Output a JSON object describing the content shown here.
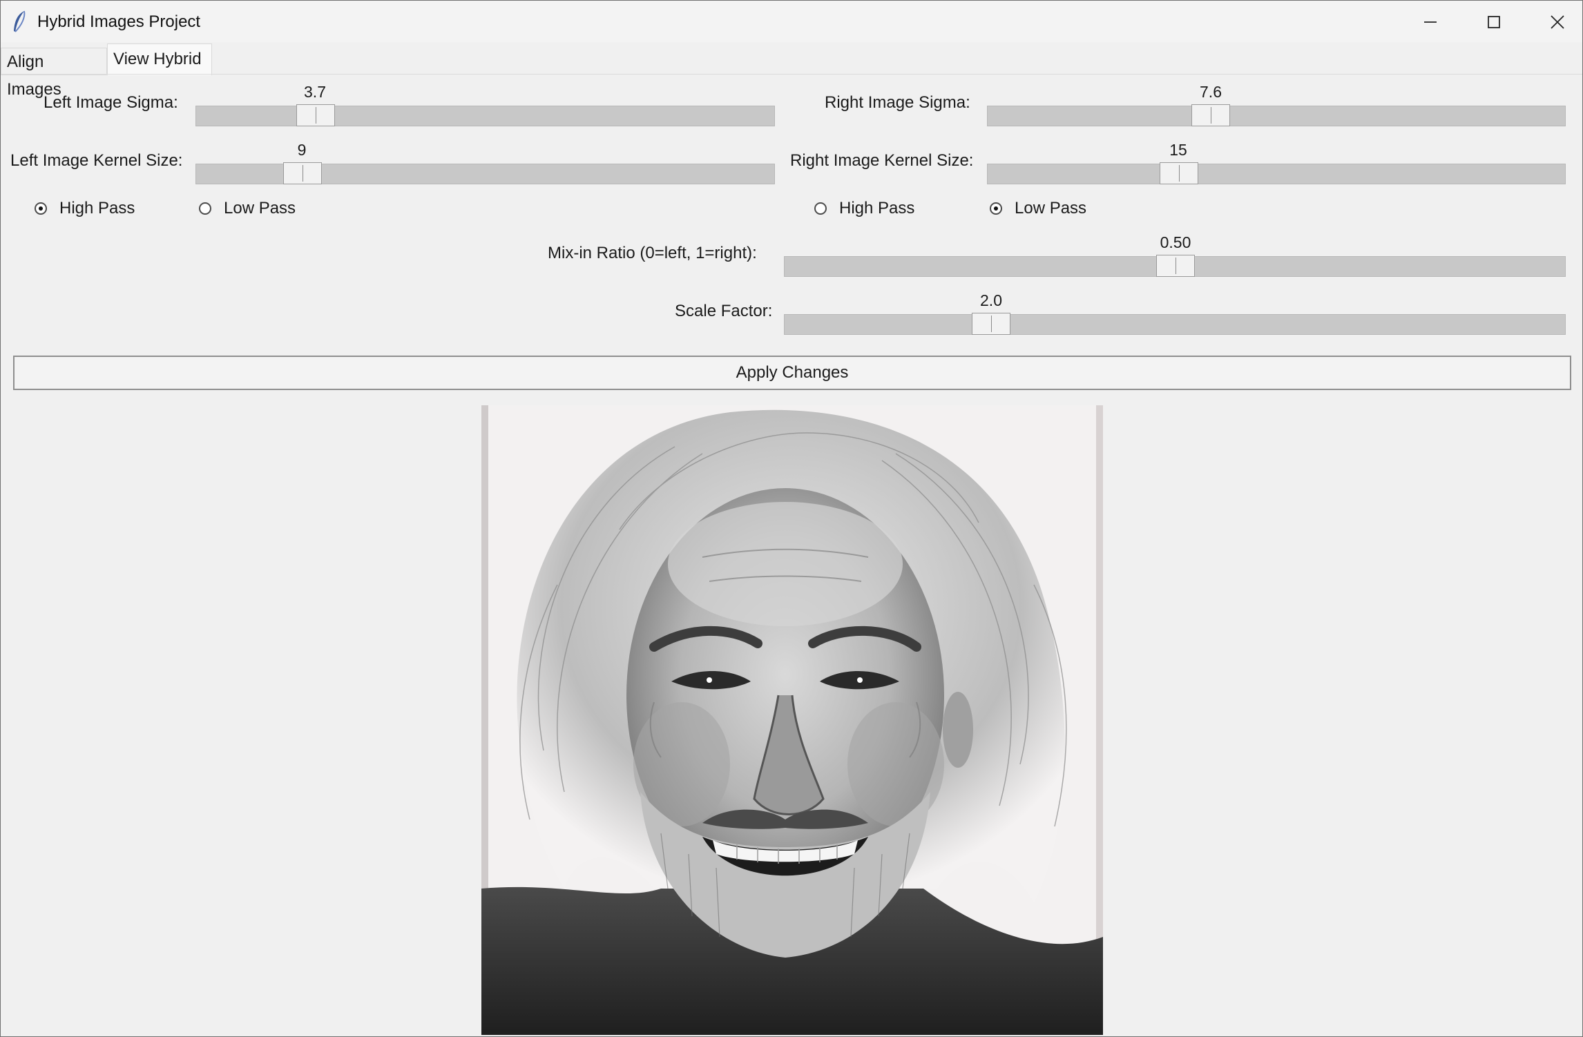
{
  "window": {
    "title": "Hybrid Images Project",
    "app_icon": "feather-icon",
    "controls": [
      "minimize-icon",
      "maximize-icon",
      "close-icon"
    ]
  },
  "tabs": [
    {
      "label": "Align Images",
      "selected": false
    },
    {
      "label": "View Hybrid",
      "selected": true
    }
  ],
  "left": {
    "sigma_label": "Left Image Sigma:",
    "sigma_value": "3.7",
    "kernel_label": "Left Image Kernel Size:",
    "kernel_value": "9",
    "high_pass_label": "High Pass",
    "low_pass_label": "Low Pass",
    "filter_selected": "High Pass"
  },
  "right": {
    "sigma_label": "Right Image Sigma:",
    "sigma_value": "7.6",
    "kernel_label": "Right Image Kernel Size:",
    "kernel_value": "15",
    "high_pass_label": "High Pass",
    "low_pass_label": "Low Pass",
    "filter_selected": "Low Pass"
  },
  "mix": {
    "label": "Mix-in Ratio (0=left, 1=right):",
    "value": "0.50"
  },
  "scale": {
    "label": "Scale Factor:",
    "value": "2.0"
  },
  "apply_button": "Apply Changes",
  "colors": {
    "background": "#f0f0f0",
    "slider_trough": "#c8c8c8",
    "thumb": "#f2f2f2"
  }
}
